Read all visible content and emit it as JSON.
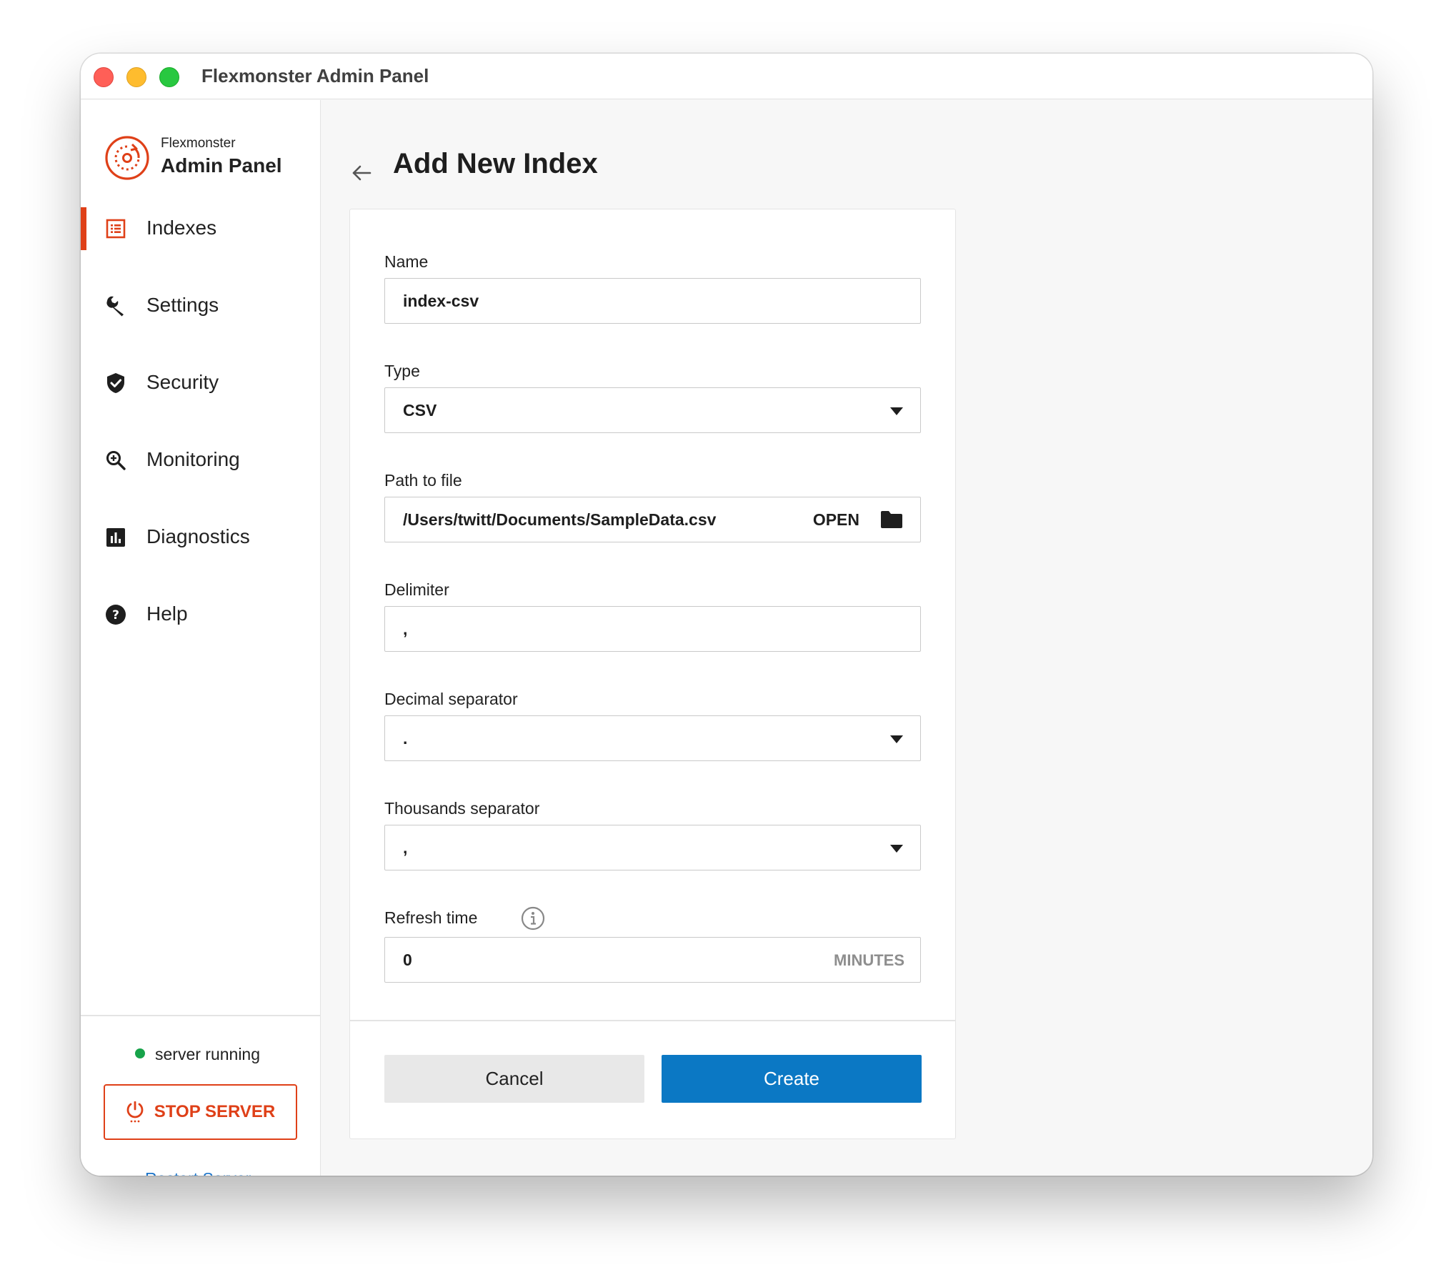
{
  "window": {
    "title": "Flexmonster Admin Panel"
  },
  "brand": {
    "small": "Flexmonster",
    "big": "Admin Panel",
    "accent_color": "#df4018"
  },
  "sidebar": {
    "items": [
      {
        "label": "Indexes",
        "icon": "list-icon",
        "active": true
      },
      {
        "label": "Settings",
        "icon": "wrench-icon",
        "active": false
      },
      {
        "label": "Security",
        "icon": "shield-icon",
        "active": false
      },
      {
        "label": "Monitoring",
        "icon": "zoom-icon",
        "active": false
      },
      {
        "label": "Diagnostics",
        "icon": "bar-chart-icon",
        "active": false
      },
      {
        "label": "Help",
        "icon": "help-icon",
        "active": false
      }
    ],
    "status_text": "server running",
    "status_color": "#17a34a",
    "stop_label": "STOP SERVER",
    "restart_label": "Restart Server"
  },
  "page": {
    "title": "Add New Index"
  },
  "form": {
    "name": {
      "label": "Name",
      "value": "index-csv"
    },
    "type": {
      "label": "Type",
      "value": "CSV"
    },
    "path": {
      "label": "Path to file",
      "value": "/Users/twitt/Documents/SampleData.csv",
      "open_label": "OPEN"
    },
    "delimiter": {
      "label": "Delimiter",
      "value": ","
    },
    "decimal": {
      "label": "Decimal separator",
      "value": "."
    },
    "thousands": {
      "label": "Thousands separator",
      "value": ","
    },
    "refresh": {
      "label": "Refresh time",
      "value": "0",
      "unit": "MINUTES"
    },
    "cancel_label": "Cancel",
    "create_label": "Create",
    "primary_color": "#0b78c4"
  }
}
